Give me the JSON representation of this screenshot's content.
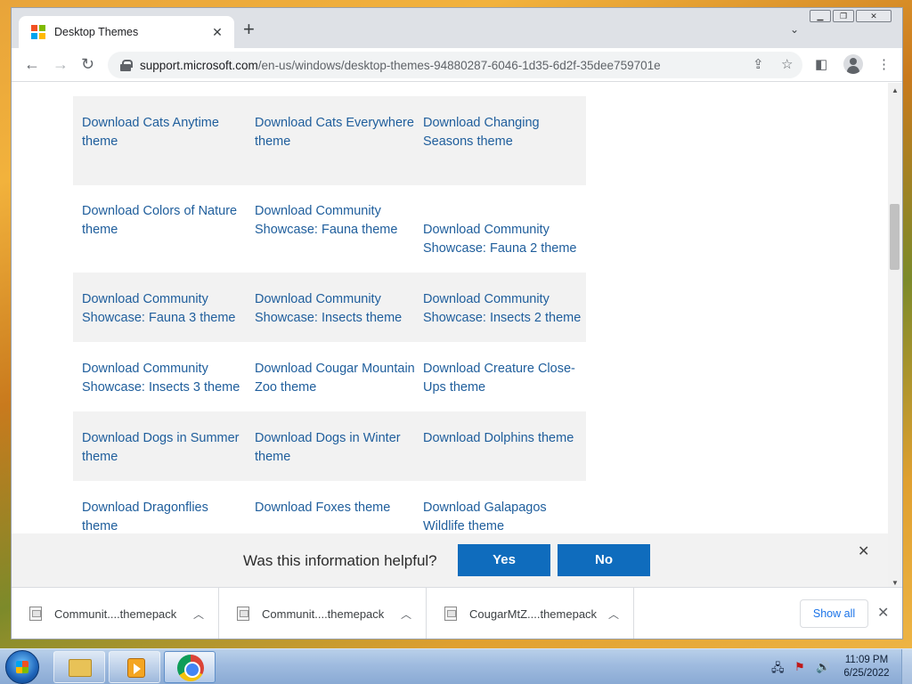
{
  "colors": {
    "link": "#1f5e9c",
    "accent_button": "#0f6cbd",
    "row_shade": "#f2f2f2"
  },
  "browser": {
    "tab_title": "Desktop Themes",
    "new_tab_icon": "plus-icon",
    "url_host": "support.microsoft.com",
    "url_path": "/en-us/windows/desktop-themes-94880287-6046-1d35-6d2f-35dee759701e",
    "window_controls": [
      "minimize",
      "restore",
      "close"
    ]
  },
  "theme_rows": [
    {
      "shaded": true,
      "cells": [
        "Download Cats Anytime theme",
        "Download Cats Everywhere theme",
        "Download Changing Seasons theme"
      ]
    },
    {
      "shaded": false,
      "cells": [
        "Download Colors of Nature theme",
        "Download Community Showcase: Fauna theme",
        "Download Community Showcase: Fauna 2 theme"
      ]
    },
    {
      "shaded": true,
      "cells": [
        "Download Community Showcase: Fauna 3 theme",
        "Download Community Showcase: Insects theme",
        "Download Community Showcase: Insects 2 theme"
      ]
    },
    {
      "shaded": false,
      "cells": [
        "Download Community Showcase: Insects 3 theme",
        "Download Cougar Mountain Zoo theme",
        "Download Creature Close-Ups theme"
      ]
    },
    {
      "shaded": true,
      "cells": [
        "Download Dogs in Summer theme",
        "Download Dogs in Winter theme",
        "Download Dolphins theme"
      ]
    },
    {
      "shaded": false,
      "cells": [
        "Download Dragonflies theme",
        "Download Foxes theme",
        "Download Galapagos Wildlife theme"
      ]
    }
  ],
  "feedback": {
    "question": "Was this information helpful?",
    "yes_label": "Yes",
    "no_label": "No"
  },
  "downloads": {
    "items": [
      {
        "name": "Communit....themepack"
      },
      {
        "name": "Communit....themepack"
      },
      {
        "name": "CougarMtZ....themepack"
      }
    ],
    "show_all_label": "Show all"
  },
  "taskbar": {
    "time": "11:09 PM",
    "date": "6/25/2022"
  }
}
